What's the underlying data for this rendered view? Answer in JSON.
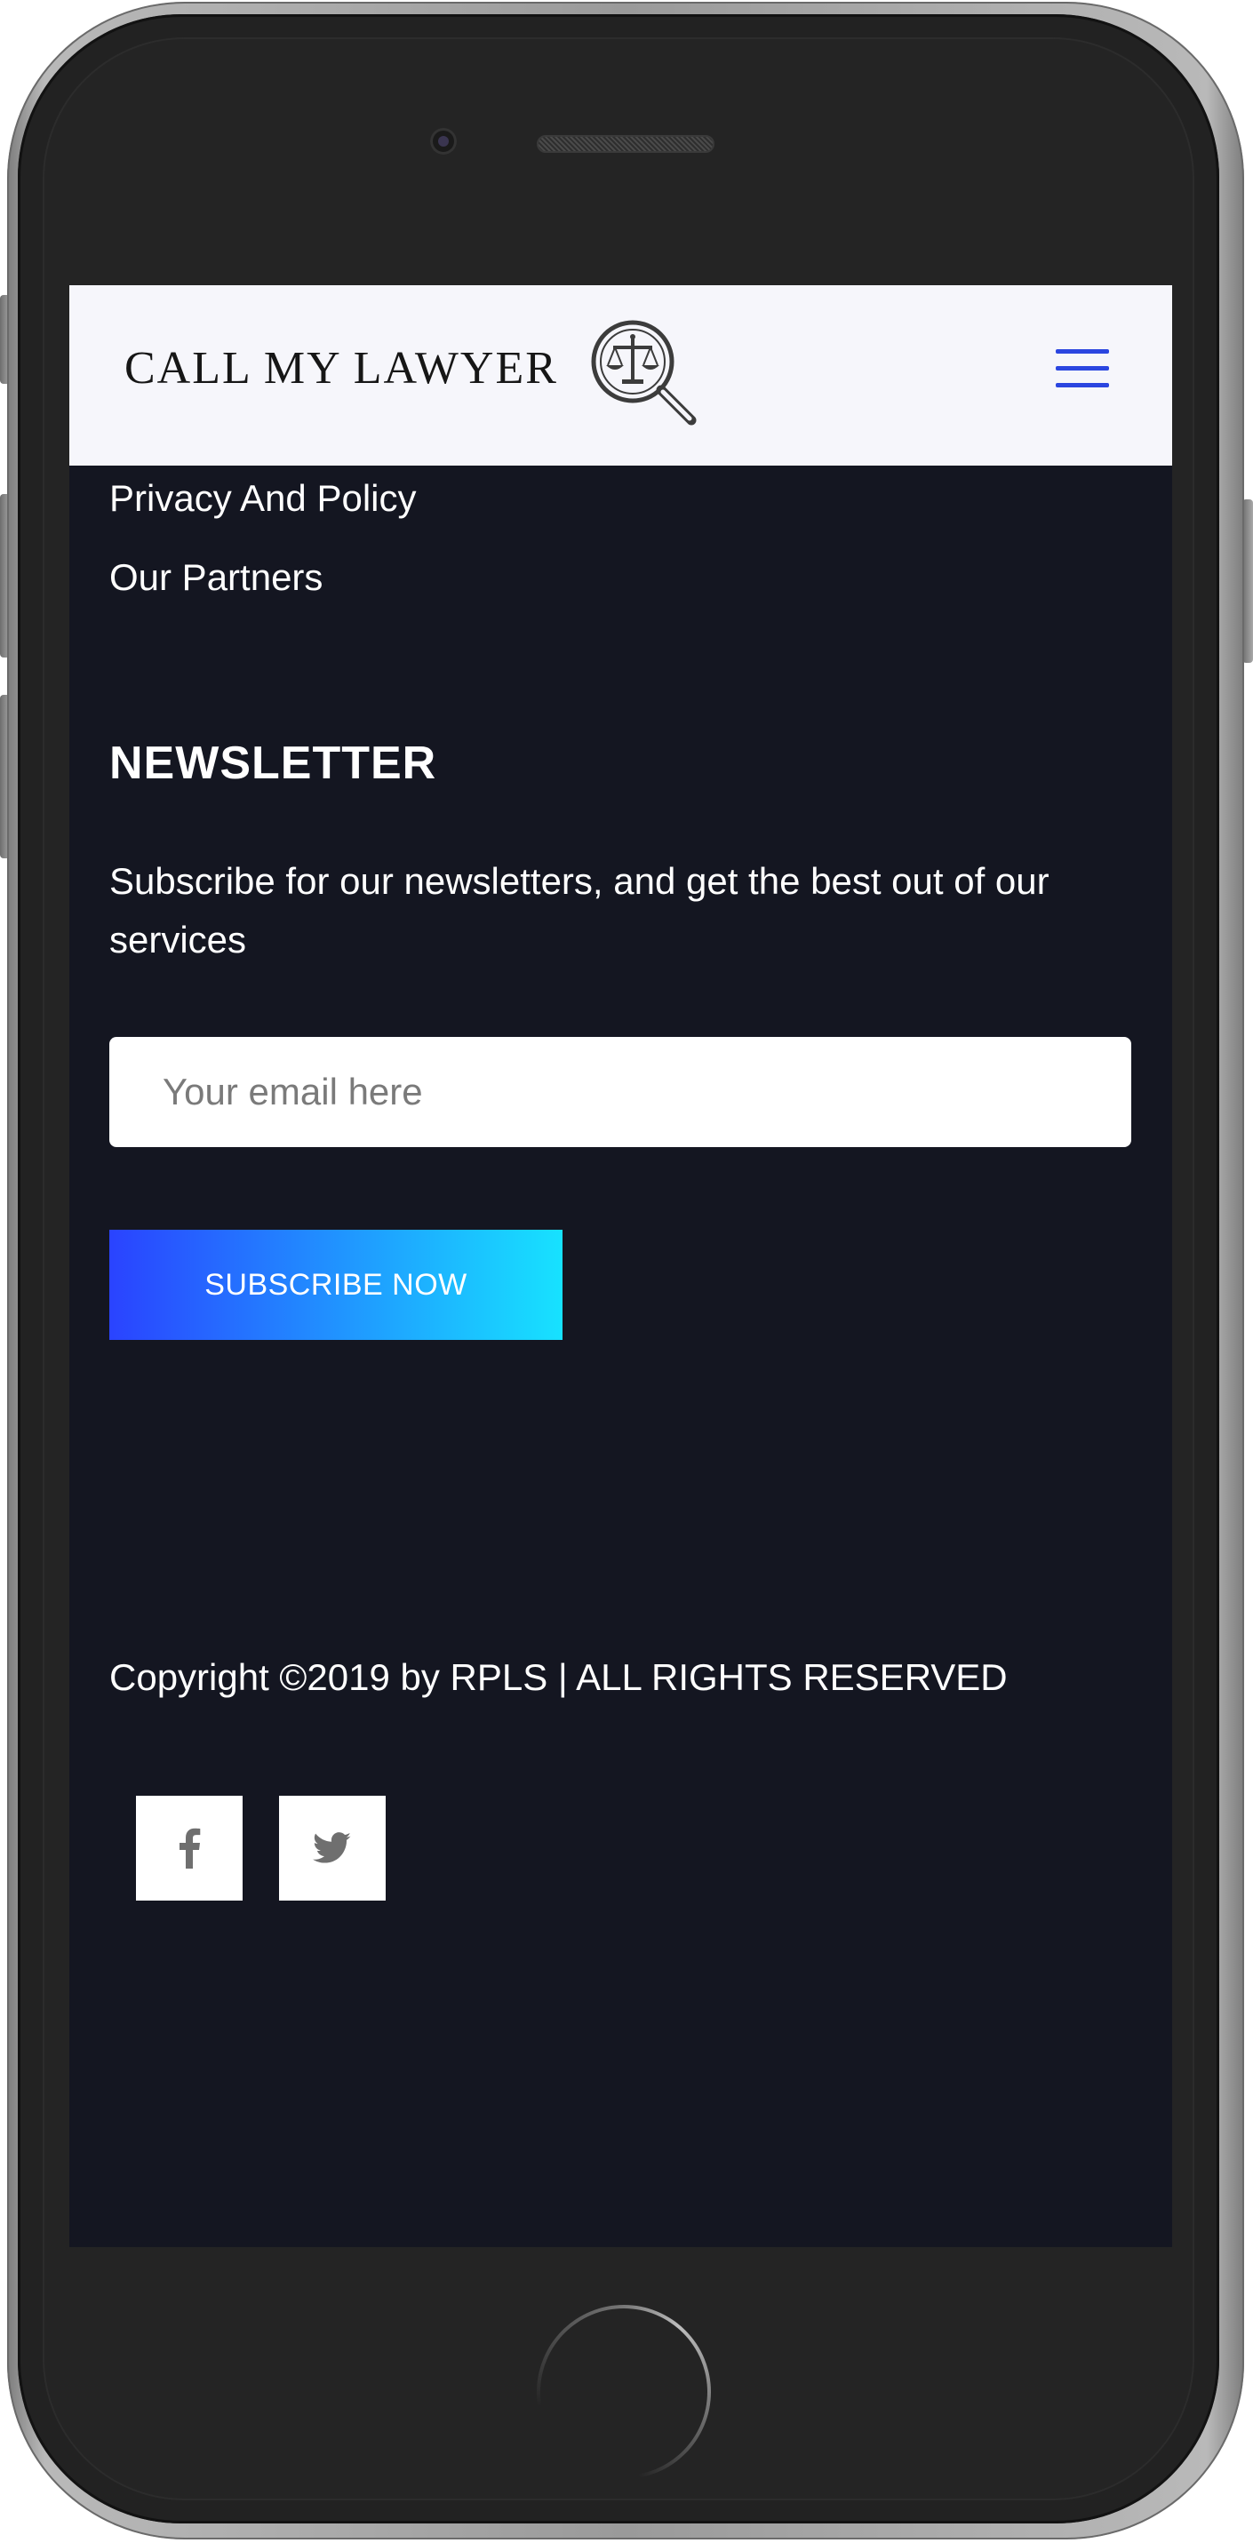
{
  "header": {
    "brand": "CALL MY LAWYER",
    "logo_icon": "scales-magnifier-icon",
    "menu_icon": "hamburger-menu-icon",
    "menu_color": "#2b46e0"
  },
  "footer_links": [
    {
      "label": "Privacy And Policy"
    },
    {
      "label": "Our Partners"
    }
  ],
  "newsletter": {
    "title": "NEWSLETTER",
    "description": "Subscribe for our newsletters, and get the best out of our services",
    "email_placeholder": "Your email here",
    "email_value": "",
    "subscribe_label": "SUBSCRIBE NOW",
    "button_gradient": [
      "#2a43ff",
      "#17e2ff"
    ]
  },
  "copyright": "Copyright ©2019 by RPLS | ALL RIGHTS RESERVED",
  "social": [
    {
      "icon": "facebook-icon"
    },
    {
      "icon": "twitter-icon"
    }
  ],
  "colors": {
    "footer_background": "#141621",
    "header_background": "#f6f6fb"
  }
}
